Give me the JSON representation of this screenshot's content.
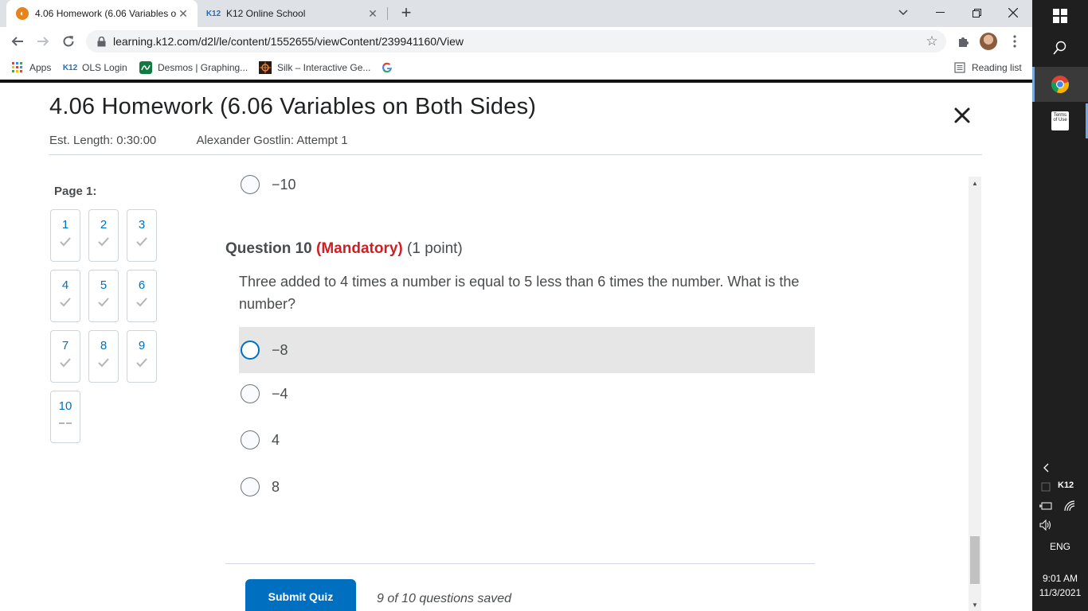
{
  "browser": {
    "tabs": [
      {
        "title": "4.06 Homework (6.06 Variables o",
        "favicon": "brightspace-icon",
        "active": true
      },
      {
        "title": "K12 Online School",
        "favicon": "k12-icon",
        "active": false
      }
    ],
    "url": "learning.k12.com/d2l/le/content/1552655/viewContent/239941160/View",
    "bookmarks": [
      {
        "label": "Apps",
        "icon": "apps-grid-icon"
      },
      {
        "label": "OLS Login",
        "icon": "k12-icon",
        "icon_text": "K12"
      },
      {
        "label": "Desmos | Graphing...",
        "icon": "desmos-icon"
      },
      {
        "label": "Silk – Interactive Ge...",
        "icon": "silk-icon"
      },
      {
        "label": "",
        "icon": "google-icon"
      }
    ],
    "reading_list": "Reading list"
  },
  "quiz": {
    "title": "4.06 Homework (6.06 Variables on Both Sides)",
    "est_length": "Est. Length: 0:30:00",
    "attempt": "Alexander Gostlin: Attempt 1",
    "page_label": "Page 1:",
    "questions_nav": [
      {
        "num": "1",
        "saved": true
      },
      {
        "num": "2",
        "saved": true
      },
      {
        "num": "3",
        "saved": true
      },
      {
        "num": "4",
        "saved": true
      },
      {
        "num": "5",
        "saved": true
      },
      {
        "num": "6",
        "saved": true
      },
      {
        "num": "7",
        "saved": true
      },
      {
        "num": "8",
        "saved": true
      },
      {
        "num": "9",
        "saved": true
      },
      {
        "num": "10",
        "saved": false
      }
    ],
    "prev_last_option": "−10",
    "question": {
      "label": "Question 10",
      "mandatory": "(Mandatory)",
      "points": "(1 point)",
      "text": "Three added to 4 times a number is equal to 5 less than 6 times the number. What is the number?",
      "options": [
        "−8",
        "−4",
        "4",
        "8"
      ],
      "hovered_option": 0
    },
    "submit_label": "Submit Quiz",
    "save_status": "9 of 10 questions saved"
  },
  "taskbar": {
    "tray_label": "K12",
    "language": "ENG",
    "time": "9:01 AM",
    "date": "11/3/2021",
    "terms_icon_text": "Terms of Use"
  },
  "colors": {
    "accent": "#006fbf",
    "mandatory": "#cd2026",
    "text": "#494c4e"
  }
}
